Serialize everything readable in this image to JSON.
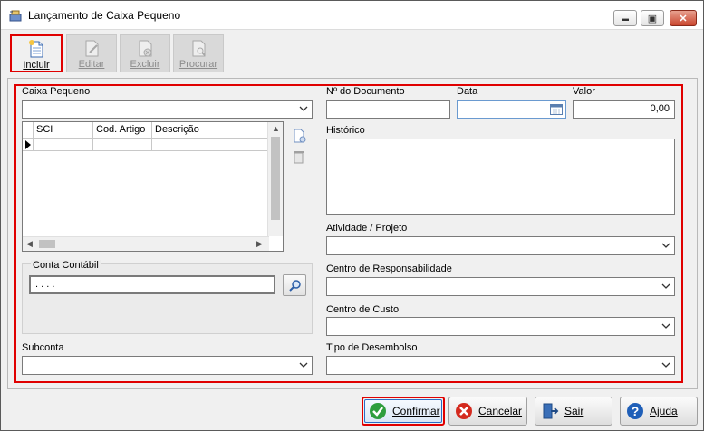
{
  "window": {
    "title": "Lançamento de Caixa Pequeno",
    "minimize": "▬",
    "maximize": "▣",
    "close": "✕"
  },
  "toolbar": {
    "incluir": "Incluir",
    "editar": "Editar",
    "excluir": "Excluir",
    "procurar": "Procurar"
  },
  "form": {
    "caixa_pequeno_label": "Caixa Pequeno",
    "numero_documento_label": "Nº do Documento",
    "data_label": "Data",
    "valor_label": "Valor",
    "valor_value": "0,00",
    "historico_label": "Histórico",
    "atividade_label": "Atividade / Projeto",
    "centro_resp_label": "Centro de Responsabilidade",
    "centro_custo_label": "Centro de Custo",
    "conta_contabil_label": "Conta Contábil",
    "conta_contabil_value": " .  .  .  .",
    "subconta_label": "Subconta",
    "tipo_desembolso_label": "Tipo de Desembolso"
  },
  "grid": {
    "columns": [
      "SCI",
      "Cod. Artigo",
      "Descrição"
    ]
  },
  "buttons": {
    "confirmar": "Confirmar",
    "cancelar": "Cancelar",
    "sair": "Sair",
    "ajuda": "Ajuda"
  },
  "colors": {
    "highlight": "#e00000",
    "confirm_green": "#2e9e3e",
    "cancel_red": "#d42a1e",
    "help_blue": "#1f5fb8"
  }
}
